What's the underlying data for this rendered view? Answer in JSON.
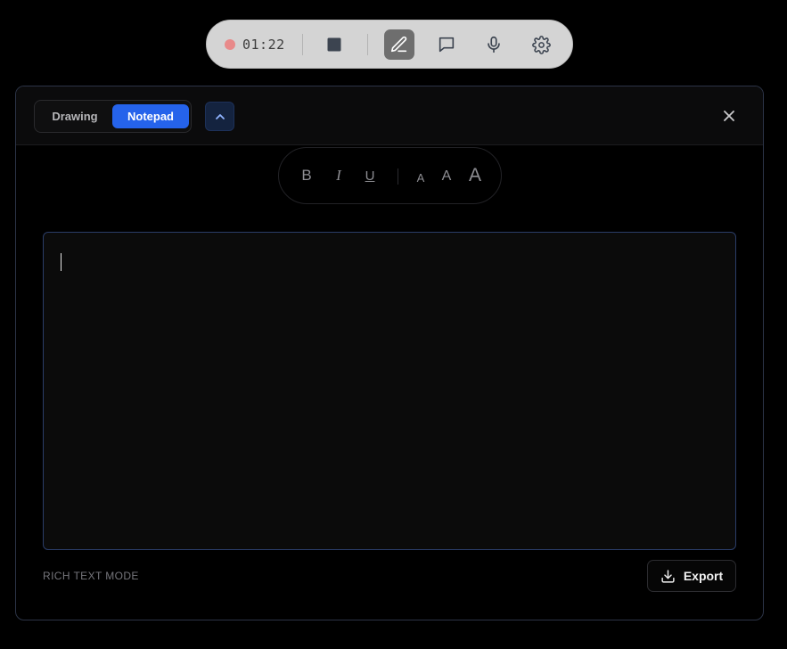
{
  "recording_bar": {
    "status": "recording",
    "elapsed": "01:22",
    "dot_color": "#e88a8a",
    "tools": [
      {
        "name": "stop",
        "icon": "stop-icon",
        "active": false
      },
      {
        "name": "pen",
        "icon": "pen-icon",
        "active": true
      },
      {
        "name": "comment",
        "icon": "chat-bubble-icon",
        "active": false
      },
      {
        "name": "microphone",
        "icon": "microphone-icon",
        "active": false
      },
      {
        "name": "settings",
        "icon": "gear-icon",
        "active": false
      }
    ]
  },
  "panel": {
    "modes": {
      "drawing_label": "Drawing",
      "notepad_label": "Notepad",
      "selected": "Notepad"
    },
    "collapse_icon": "chevron-up-icon",
    "close_icon": "close-icon",
    "formatting": {
      "bold_label": "B",
      "italic_label": "I",
      "underline_label": "U",
      "size_small_label": "A",
      "size_medium_label": "A",
      "size_large_label": "A"
    },
    "editor": {
      "content": ""
    },
    "footer": {
      "mode_caption": "RICH TEXT MODE",
      "export_label": "Export",
      "export_icon": "download-icon"
    }
  },
  "colors": {
    "accent": "#2563eb",
    "background": "#000000",
    "panel_border": "#2c3447",
    "editor_border": "#2b3d68",
    "recording_dot": "#e88a8a"
  }
}
